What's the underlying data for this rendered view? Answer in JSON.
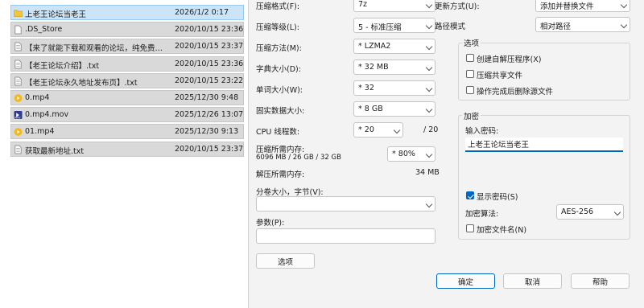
{
  "files": [
    {
      "name": "上老王论坛当老王",
      "date": "2026/1/2 0:17",
      "icon": "folder-icon",
      "selected": true
    },
    {
      "name": ".DS_Store",
      "date": "2020/10/15 23:36",
      "icon": "file-icon"
    },
    {
      "name": "【来了就能下载和观看的论坛，纯免费！...",
      "date": "2020/10/15 23:37",
      "icon": "text-file-icon"
    },
    {
      "name": "【老王论坛介绍】.txt",
      "date": "2020/10/15 23:36",
      "icon": "text-file-icon"
    },
    {
      "name": "【老王论坛永久地址发布页】.txt",
      "date": "2020/10/15 23:22",
      "icon": "text-file-icon"
    },
    {
      "name": "0.mp4",
      "date": "2025/12/30 9:48",
      "icon": "video-file-icon"
    },
    {
      "name": "0.mp4.mov",
      "date": "2025/12/26 13:07",
      "icon": "mov-file-icon"
    },
    {
      "name": "01.mp4",
      "date": "2025/12/30 9:13",
      "icon": "video-file-icon"
    },
    {
      "name": "获取最新地址.txt",
      "date": "2020/10/15 23:37",
      "icon": "text-file-icon"
    }
  ],
  "dialog": {
    "left": {
      "format": {
        "label": "压缩格式(F):",
        "value": "7z"
      },
      "level": {
        "label": "压缩等级(L):",
        "value": "5 - 标准压缩"
      },
      "method": {
        "label": "压缩方法(M):",
        "value": "* LZMA2"
      },
      "dict": {
        "label": "字典大小(D):",
        "value": "* 32 MB"
      },
      "word": {
        "label": "单词大小(W):",
        "value": "* 32"
      },
      "solid": {
        "label": "固实数据大小:",
        "value": "* 8 GB"
      },
      "threads": {
        "label": "CPU 线程数:",
        "value": "* 20",
        "max": "/ 20"
      },
      "mem_compress": {
        "label": "压缩所需内存:",
        "detail": "6096 MB / 26 GB / 32 GB",
        "percent": "* 80%"
      },
      "mem_decompress": {
        "label": "解压所需内存:",
        "value": "34 MB"
      },
      "split": {
        "label": "分卷大小，字节(V):",
        "value": ""
      },
      "params": {
        "label": "参数(P):",
        "value": ""
      },
      "options_button": "选项"
    },
    "right": {
      "update": {
        "label": "更新方式(U):",
        "value": "添加并替换文件"
      },
      "pathmode": {
        "label": "路径模式",
        "value": "相对路径"
      },
      "options": {
        "title": "选项",
        "items": [
          {
            "label": "创建自解压程序(X)",
            "checked": false
          },
          {
            "label": "压缩共享文件",
            "checked": false
          },
          {
            "label": "操作完成后删除源文件",
            "checked": false
          }
        ]
      },
      "encryption": {
        "title": "加密",
        "pwd_label": "输入密码:",
        "pwd_value": "上老王论坛当老王",
        "show_pwd": {
          "label": "显示密码(S)",
          "checked": true
        },
        "method_label": "加密算法:",
        "method_value": "AES-256",
        "encrypt_names": {
          "label": "加密文件名(N)",
          "checked": false
        }
      }
    },
    "buttons": {
      "ok": "确定",
      "cancel": "取消",
      "help": "帮助"
    }
  },
  "colors": {
    "accent": "#0067c0",
    "selection": "#cce4f7"
  }
}
